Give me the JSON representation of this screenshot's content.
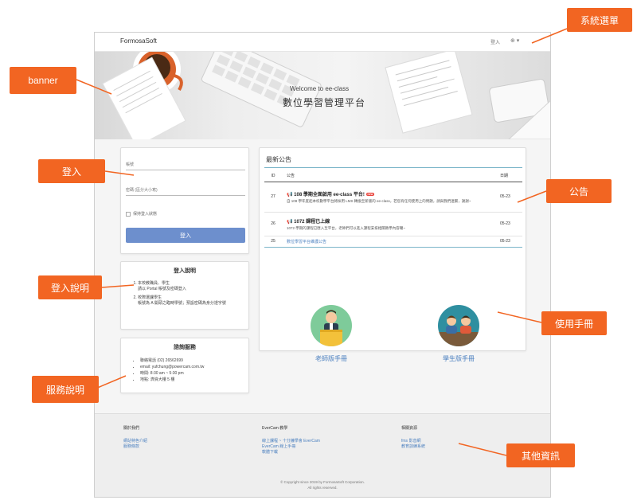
{
  "navbar": {
    "brand": "FormosaSoft",
    "login": "登入",
    "language": "⊕ ▾"
  },
  "banner": {
    "welcome": "Welcome to ee-class",
    "title": "數位學習管理平台"
  },
  "login_form": {
    "account_placeholder": "帳號",
    "password_placeholder": "密碼 (區分大小寫)",
    "remember": "保持登入狀態",
    "submit": "登入"
  },
  "login_help": {
    "title": "登入說明",
    "items": [
      "本校教職員、學生\n請以 Portal 帳號及密碼登入",
      "校際選課學生\n帳號為 A 開頭之臨時學號；預設密碼為身分證字號"
    ]
  },
  "service": {
    "title": "諮詢服務",
    "items": [
      "聯絡電話 (02) 26562699",
      "email: yufchung@powercam.com.tw",
      "時間: 8:30 am ~ 5:30 pm",
      "地點: 濟資大樓 5 樓"
    ]
  },
  "news": {
    "title": "最新公告",
    "columns": {
      "id": "ID",
      "notice": "公告",
      "date": "日期"
    },
    "rows": [
      {
        "id": "27",
        "title": "108 學期全面啟用 ee-class 平台!",
        "badge": "new",
        "body": "自 108 學年度起本校數學平台將採用 LMS 轉換至新版的 ee-class，若您有任何使用上的問題，請與我們連繫，謝謝~",
        "date": "05-23"
      },
      {
        "id": "26",
        "title": "1072 課程已上線",
        "badge": "",
        "body": "1072 學期的課程已匯入至平台，老師們可以進入課程安排相關教學內容囉~",
        "date": "05-23"
      },
      {
        "id": "25",
        "title": "數位學習平台維護公告",
        "badge": "",
        "body": "",
        "date": "05-23"
      }
    ]
  },
  "manuals": {
    "teacher": "老師版手冊",
    "student": "學生版手冊"
  },
  "footer": {
    "about": {
      "title": "關於我們",
      "links": [
        "網站特色介紹",
        "服務條款"
      ]
    },
    "evercam": {
      "title": "EverCam 教學",
      "links": [
        "線上課程 ~ 十分鐘學會 EverCam",
        "EverCam 線上手冊",
        "軟體下載"
      ]
    },
    "resources": {
      "title": "相關資源",
      "links": [
        "fms 影音網",
        "教育訓練系統"
      ]
    },
    "copyright": "© Copyright since 2019 by FormosaSoft Corporation.",
    "rights": "All rights reserved."
  },
  "callouts": {
    "system_menu": "系統選單",
    "banner": "banner",
    "login": "登入",
    "announcement": "公告",
    "login_help": "登入說明",
    "manual": "使用手冊",
    "service": "服務說明",
    "other_info": "其他資訊"
  },
  "colors": {
    "callout": "#f26522",
    "login_button": "#6d8fcd",
    "link": "#4a7fbf",
    "accent_rule": "#7bb5c9"
  }
}
